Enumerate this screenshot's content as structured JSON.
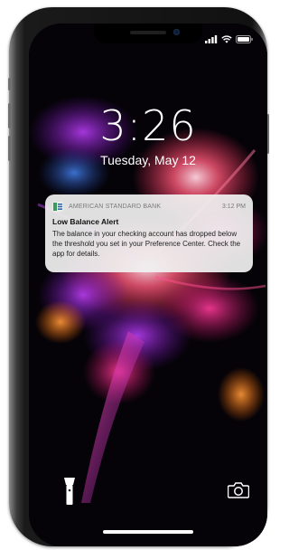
{
  "status_bar": {
    "icons": [
      "signal-icon",
      "wifi-icon",
      "battery-icon"
    ]
  },
  "lock_screen": {
    "time": "3:26",
    "date": "Tuesday, May 12"
  },
  "notification": {
    "app_name": "AMERICAN STANDARD BANK",
    "time": "3:12 PM",
    "title": "Low Balance Alert",
    "body": "The balance in your checking account has dropped below the threshold you set in your Preference Center. Check the app for details."
  },
  "bottom_controls": {
    "left_icon": "flashlight-icon",
    "right_icon": "camera-icon"
  },
  "colors": {
    "notification_bg": "#f0f0f0",
    "app_icon_green": "#3c9a5f",
    "app_icon_blue": "#2f5f9e",
    "text_secondary": "#7a7a7a"
  }
}
